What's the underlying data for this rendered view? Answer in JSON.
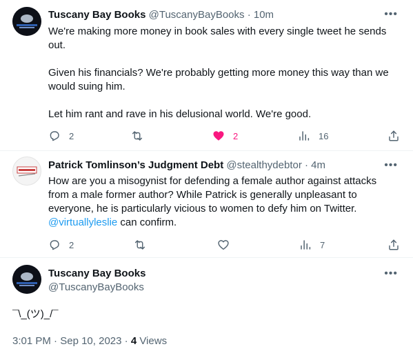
{
  "tweets": [
    {
      "author_name": "Tuscany Bay Books",
      "handle": "@TuscanyBayBooks",
      "separator": "·",
      "time": "10m",
      "text_lines": [
        "We're making more money in book sales with every single tweet he sends out.",
        "Given his financials? We're probably getting more money this way than we would suing him.",
        "Let him rant and rave in his delusional world. We're good."
      ],
      "actions": {
        "replies": "2",
        "retweets": "",
        "likes": "2",
        "views": "16"
      },
      "liked": true
    },
    {
      "author_name": "Patrick Tomlinson’s Judgment Debt",
      "handle": "@stealthydebtor",
      "separator": "·",
      "time": "4m",
      "text_main": "How are you a misogynist for defending a female author against attacks from a male former author? While Patrick is generally unpleasant to everyone, he is particularly vicious to women to defy him on Twitter.",
      "mention": "@virtuallyleslie",
      "text_tail": " can confirm.",
      "actions": {
        "replies": "2",
        "retweets": "",
        "likes": "",
        "views": "7"
      },
      "liked": false
    }
  ],
  "main_tweet": {
    "author_name": "Tuscany Bay Books",
    "handle": "@TuscanyBayBooks",
    "text": "¯\\_(ツ)_/¯",
    "time": "3:01 PM",
    "dot": "·",
    "date": "Sep 10, 2023",
    "views_count": "4",
    "views_label": "Views"
  },
  "icons": {
    "more": "ellipsis-icon",
    "reply": "reply-icon",
    "retweet": "retweet-icon",
    "like": "heart-icon",
    "views": "views-icon",
    "share": "share-icon"
  },
  "colors": {
    "text": "#0f1419",
    "secondary": "#536471",
    "link": "#1d9bf0",
    "like": "#f91880",
    "divider": "#eff3f4"
  }
}
